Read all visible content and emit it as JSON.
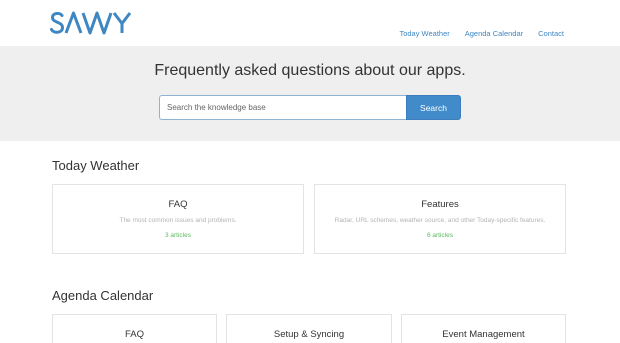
{
  "brand": {
    "logo_text": "SAVVY",
    "logo_color": "#3e87c3"
  },
  "nav": {
    "items": [
      {
        "label": "Today Weather"
      },
      {
        "label": "Agenda Calendar"
      },
      {
        "label": "Contact"
      }
    ]
  },
  "hero": {
    "title": "Frequently asked questions about our apps.",
    "search_placeholder": "Search the knowledge base",
    "search_value": "",
    "search_button_label": "Search"
  },
  "sections": [
    {
      "title": "Today Weather",
      "cards": [
        {
          "title": "FAQ",
          "description": "The most common issues and problems.",
          "count": "3 articles"
        },
        {
          "title": "Features",
          "description": "Radar, URL schemes, weather source, and other Today-specific features.",
          "count": "6 articles"
        }
      ]
    },
    {
      "title": "Agenda Calendar",
      "cards": [
        {
          "title": "FAQ"
        },
        {
          "title": "Setup & Syncing"
        },
        {
          "title": "Event Management"
        }
      ]
    }
  ],
  "colors": {
    "accent": "#428bca",
    "hero_background": "#efefef",
    "article_count": "#5cb85c"
  }
}
